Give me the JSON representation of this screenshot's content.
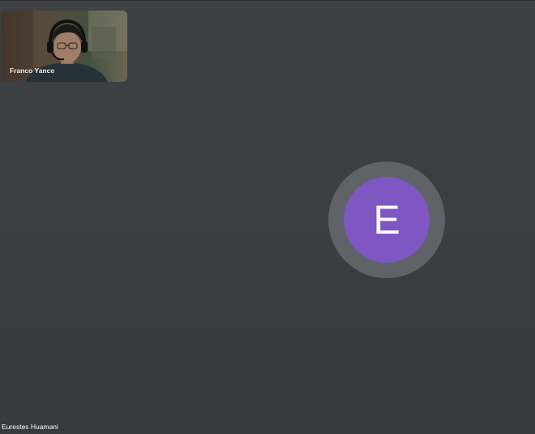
{
  "call": {
    "self_tile": {
      "participant_name": "Franco Yance"
    },
    "main_tile": {
      "avatar_initial": "E",
      "avatar_color": "#7e57c2",
      "participant_name": "Eurestes Huamani"
    }
  }
}
